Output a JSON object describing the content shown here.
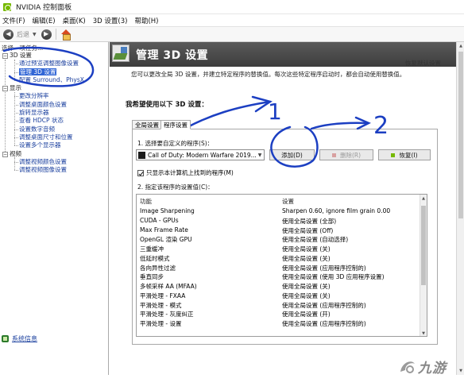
{
  "window": {
    "title": "NVIDIA 控制面板"
  },
  "menu": [
    "文件(F)",
    "编辑(E)",
    "桌面(K)",
    "3D 设置(3)",
    "帮助(H)"
  ],
  "toolbar": {
    "back_label": "后退"
  },
  "sidebar": {
    "task_label": "选择一项任务...",
    "categories": [
      {
        "label": "3D 设置",
        "items": [
          "通过预览调整图像设置",
          "管理 3D 设置",
          "配置 Surround、PhysX"
        ]
      },
      {
        "label": "显示",
        "items": [
          "更改分辨率",
          "调整桌面颜色设置",
          "旋转显示器",
          "查看 HDCP 状态",
          "设置数字音频",
          "调整桌面尺寸和位置",
          "设置多个显示器"
        ]
      },
      {
        "label": "视频",
        "items": [
          "调整视频颜色设置",
          "调整视频图像设置"
        ]
      }
    ],
    "selected_item": "管理 3D 设置",
    "system_info": "系统信息"
  },
  "page": {
    "title": "管理 3D 设置",
    "restore_defaults": "恢复默认设置",
    "description": "您可以更改全局 3D 设置，并建立特定程序的替换值。每次这些特定程序启动时，都会自动使用替换值。",
    "section_title": "我希望使用以下 3D 设置：",
    "tabs": [
      "全局设置",
      "程序设置"
    ],
    "active_tab": "程序设置",
    "step1_label": "1. 选择要自定义的程序(S)：",
    "program_selected": "Call of Duty: Modern Warfare 2019...",
    "buttons": {
      "add": "添加(D)",
      "remove": "删除(R)",
      "restore": "恢复(I)"
    },
    "checkbox_label": "只显示本计算机上找到的程序(M)",
    "checkbox_checked": true,
    "step2_label": "2. 指定该程序的设置值(C)：",
    "table": {
      "headers": [
        "功能",
        "设置"
      ],
      "rows": [
        [
          "Image Sharpening",
          "Sharpen 0.60, ignore film grain 0.00"
        ],
        [
          "CUDA - GPUs",
          "使用全局设置 (全部)"
        ],
        [
          "Max Frame Rate",
          "使用全局设置 (Off)"
        ],
        [
          "OpenGL 渲染 GPU",
          "使用全局设置 (自动选择)"
        ],
        [
          "三重缓冲",
          "使用全局设置 (关)"
        ],
        [
          "低延时模式",
          "使用全局设置 (关)"
        ],
        [
          "各向异性过滤",
          "使用全局设置 (应用程序控制的)"
        ],
        [
          "垂直同步",
          "使用全局设置 (使用 3D 应用程序设置)"
        ],
        [
          "多帧采样 AA (MFAA)",
          "使用全局设置 (关)"
        ],
        [
          "平滑处理 - FXAA",
          "使用全局设置 (关)"
        ],
        [
          "平滑处理 - 模式",
          "使用全局设置 (应用程序控制的)"
        ],
        [
          "平滑处理 - 灰度纠正",
          "使用全局设置 (开)"
        ],
        [
          "平滑处理 - 设置",
          "使用全局设置 (应用程序控制的)"
        ]
      ]
    }
  },
  "annotations": {
    "label_1": "1",
    "label_2": "2",
    "color": "#1c3fc2"
  },
  "watermark": {
    "text": "九游"
  },
  "colors": {
    "nvidia_green": "#76b900",
    "header_bg": "#4a4a4a",
    "selection": "#3166d6",
    "link": "#1a3f9e"
  }
}
